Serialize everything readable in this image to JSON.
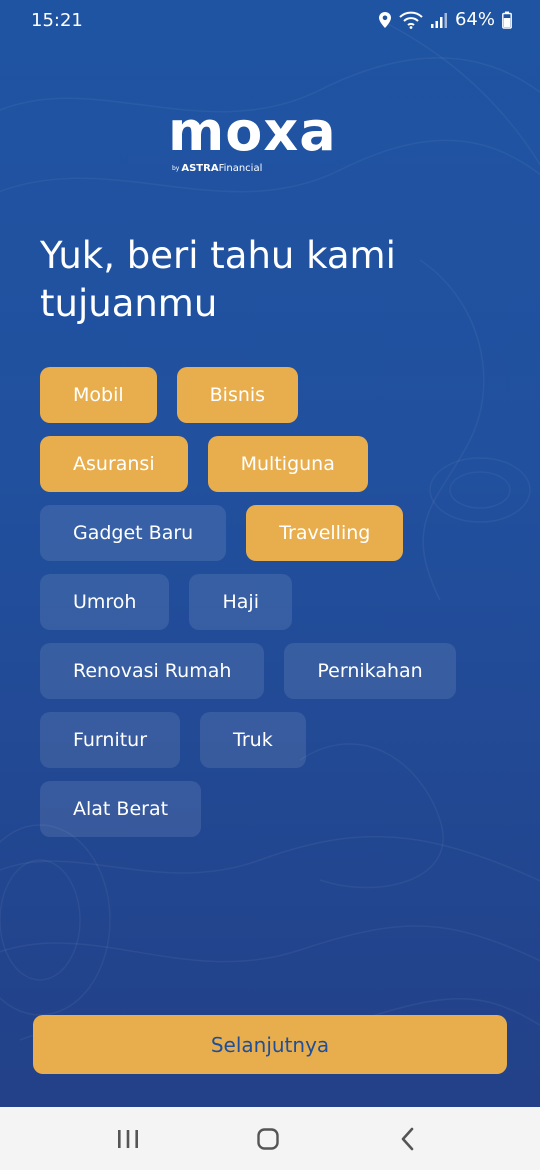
{
  "status_bar": {
    "time": "15:21",
    "battery_percent": "64%"
  },
  "logo": {
    "wordmark": "moxa",
    "by_prefix": "by",
    "brand_bold": "ASTRA",
    "brand_light": "Financial"
  },
  "heading": {
    "line1": "Yuk, beri tahu kami",
    "line2": "tujuanmu"
  },
  "goals": [
    {
      "label": "Mobil",
      "selected": true
    },
    {
      "label": "Bisnis",
      "selected": true
    },
    {
      "label": "Asuransi",
      "selected": true
    },
    {
      "label": "Multiguna",
      "selected": true
    },
    {
      "label": "Gadget Baru",
      "selected": false
    },
    {
      "label": "Travelling",
      "selected": true
    },
    {
      "label": "Umroh",
      "selected": false
    },
    {
      "label": "Haji",
      "selected": false
    },
    {
      "label": "Renovasi Rumah",
      "selected": false
    },
    {
      "label": "Pernikahan",
      "selected": false
    },
    {
      "label": "Furnitur",
      "selected": false
    },
    {
      "label": "Truk",
      "selected": false
    },
    {
      "label": "Alat Berat",
      "selected": false
    }
  ],
  "next_button": {
    "label": "Selanjutnya"
  },
  "colors": {
    "background_top": "#1f54a3",
    "background_bottom": "#233f86",
    "accent": "#e8ae4d",
    "button_text": "#1f4f99"
  },
  "icons": [
    "location-icon",
    "wifi-icon",
    "signal-icon",
    "battery-icon",
    "recent-apps-icon",
    "home-icon",
    "back-icon"
  ]
}
